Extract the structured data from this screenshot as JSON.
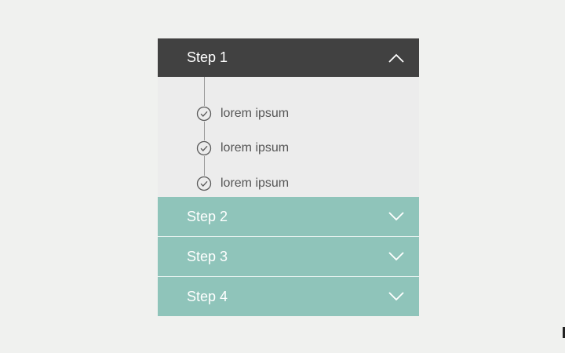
{
  "accordion": {
    "steps": [
      {
        "label": "Step 1",
        "state": "expanded"
      },
      {
        "label": "Step 2",
        "state": "collapsed"
      },
      {
        "label": "Step 3",
        "state": "collapsed"
      },
      {
        "label": "Step 4",
        "state": "collapsed"
      }
    ],
    "step1_items": [
      {
        "label": "lorem ipsum",
        "icon": "check-circle-icon"
      },
      {
        "label": "lorem ipsum",
        "icon": "check-circle-icon"
      },
      {
        "label": "lorem ipsum",
        "icon": "check-circle-icon"
      }
    ]
  },
  "colors": {
    "background": "#f0f1ef",
    "active_header": "#414141",
    "collapsed_header": "#8fc4ba",
    "panel": "#ececec",
    "item_text": "#555555"
  },
  "icons": {
    "expanded": "chevron-up-icon",
    "collapsed": "chevron-down-icon",
    "item": "check-circle-icon"
  }
}
